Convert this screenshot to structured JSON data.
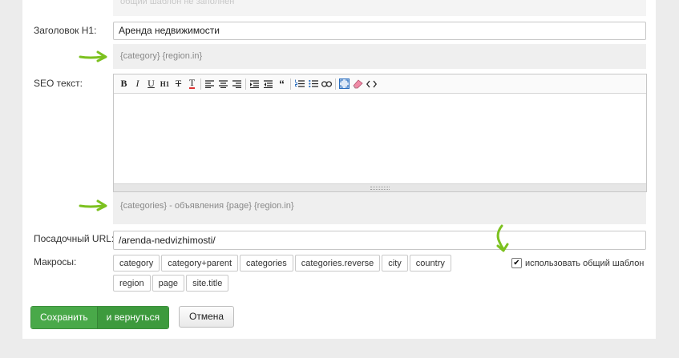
{
  "top_hint": "общий шаблон не заполнен",
  "fields": {
    "h1_label": "Заголовок H1:",
    "h1_value": "Аренда недвижимости",
    "h1_hint": "{category} {region.in}",
    "seo_label": "SEO текст:",
    "seo_hint": "{categories} - объявления {page} {region.in}",
    "url_label": "Посадочный URL:",
    "url_value": "/arenda-nedvizhimosti/",
    "macros_label": "Макросы:"
  },
  "toolbar": {
    "bold": "B",
    "italic": "I",
    "underline": "U",
    "heading": "H1",
    "clear_format": "T",
    "text_color": "T",
    "blockquote": "“"
  },
  "macros": [
    "category",
    "category+parent",
    "categories",
    "categories.reverse",
    "city",
    "country",
    "region",
    "page",
    "site.title"
  ],
  "checkbox": {
    "label": "использовать общий шаблон",
    "checked": true
  },
  "buttons": {
    "save": "Сохранить",
    "save_return": "и вернуться",
    "cancel": "Отмена"
  },
  "colors": {
    "arrow": "#7cc11f",
    "save_button": "#49a949",
    "hint_bg": "#efefef"
  },
  "icons": [
    "align-left-icon",
    "align-center-icon",
    "align-right-icon",
    "indent-icon",
    "outdent-icon",
    "ordered-list-icon",
    "unordered-list-icon",
    "link-icon",
    "fullscreen-icon",
    "eraser-icon",
    "code-icon"
  ]
}
